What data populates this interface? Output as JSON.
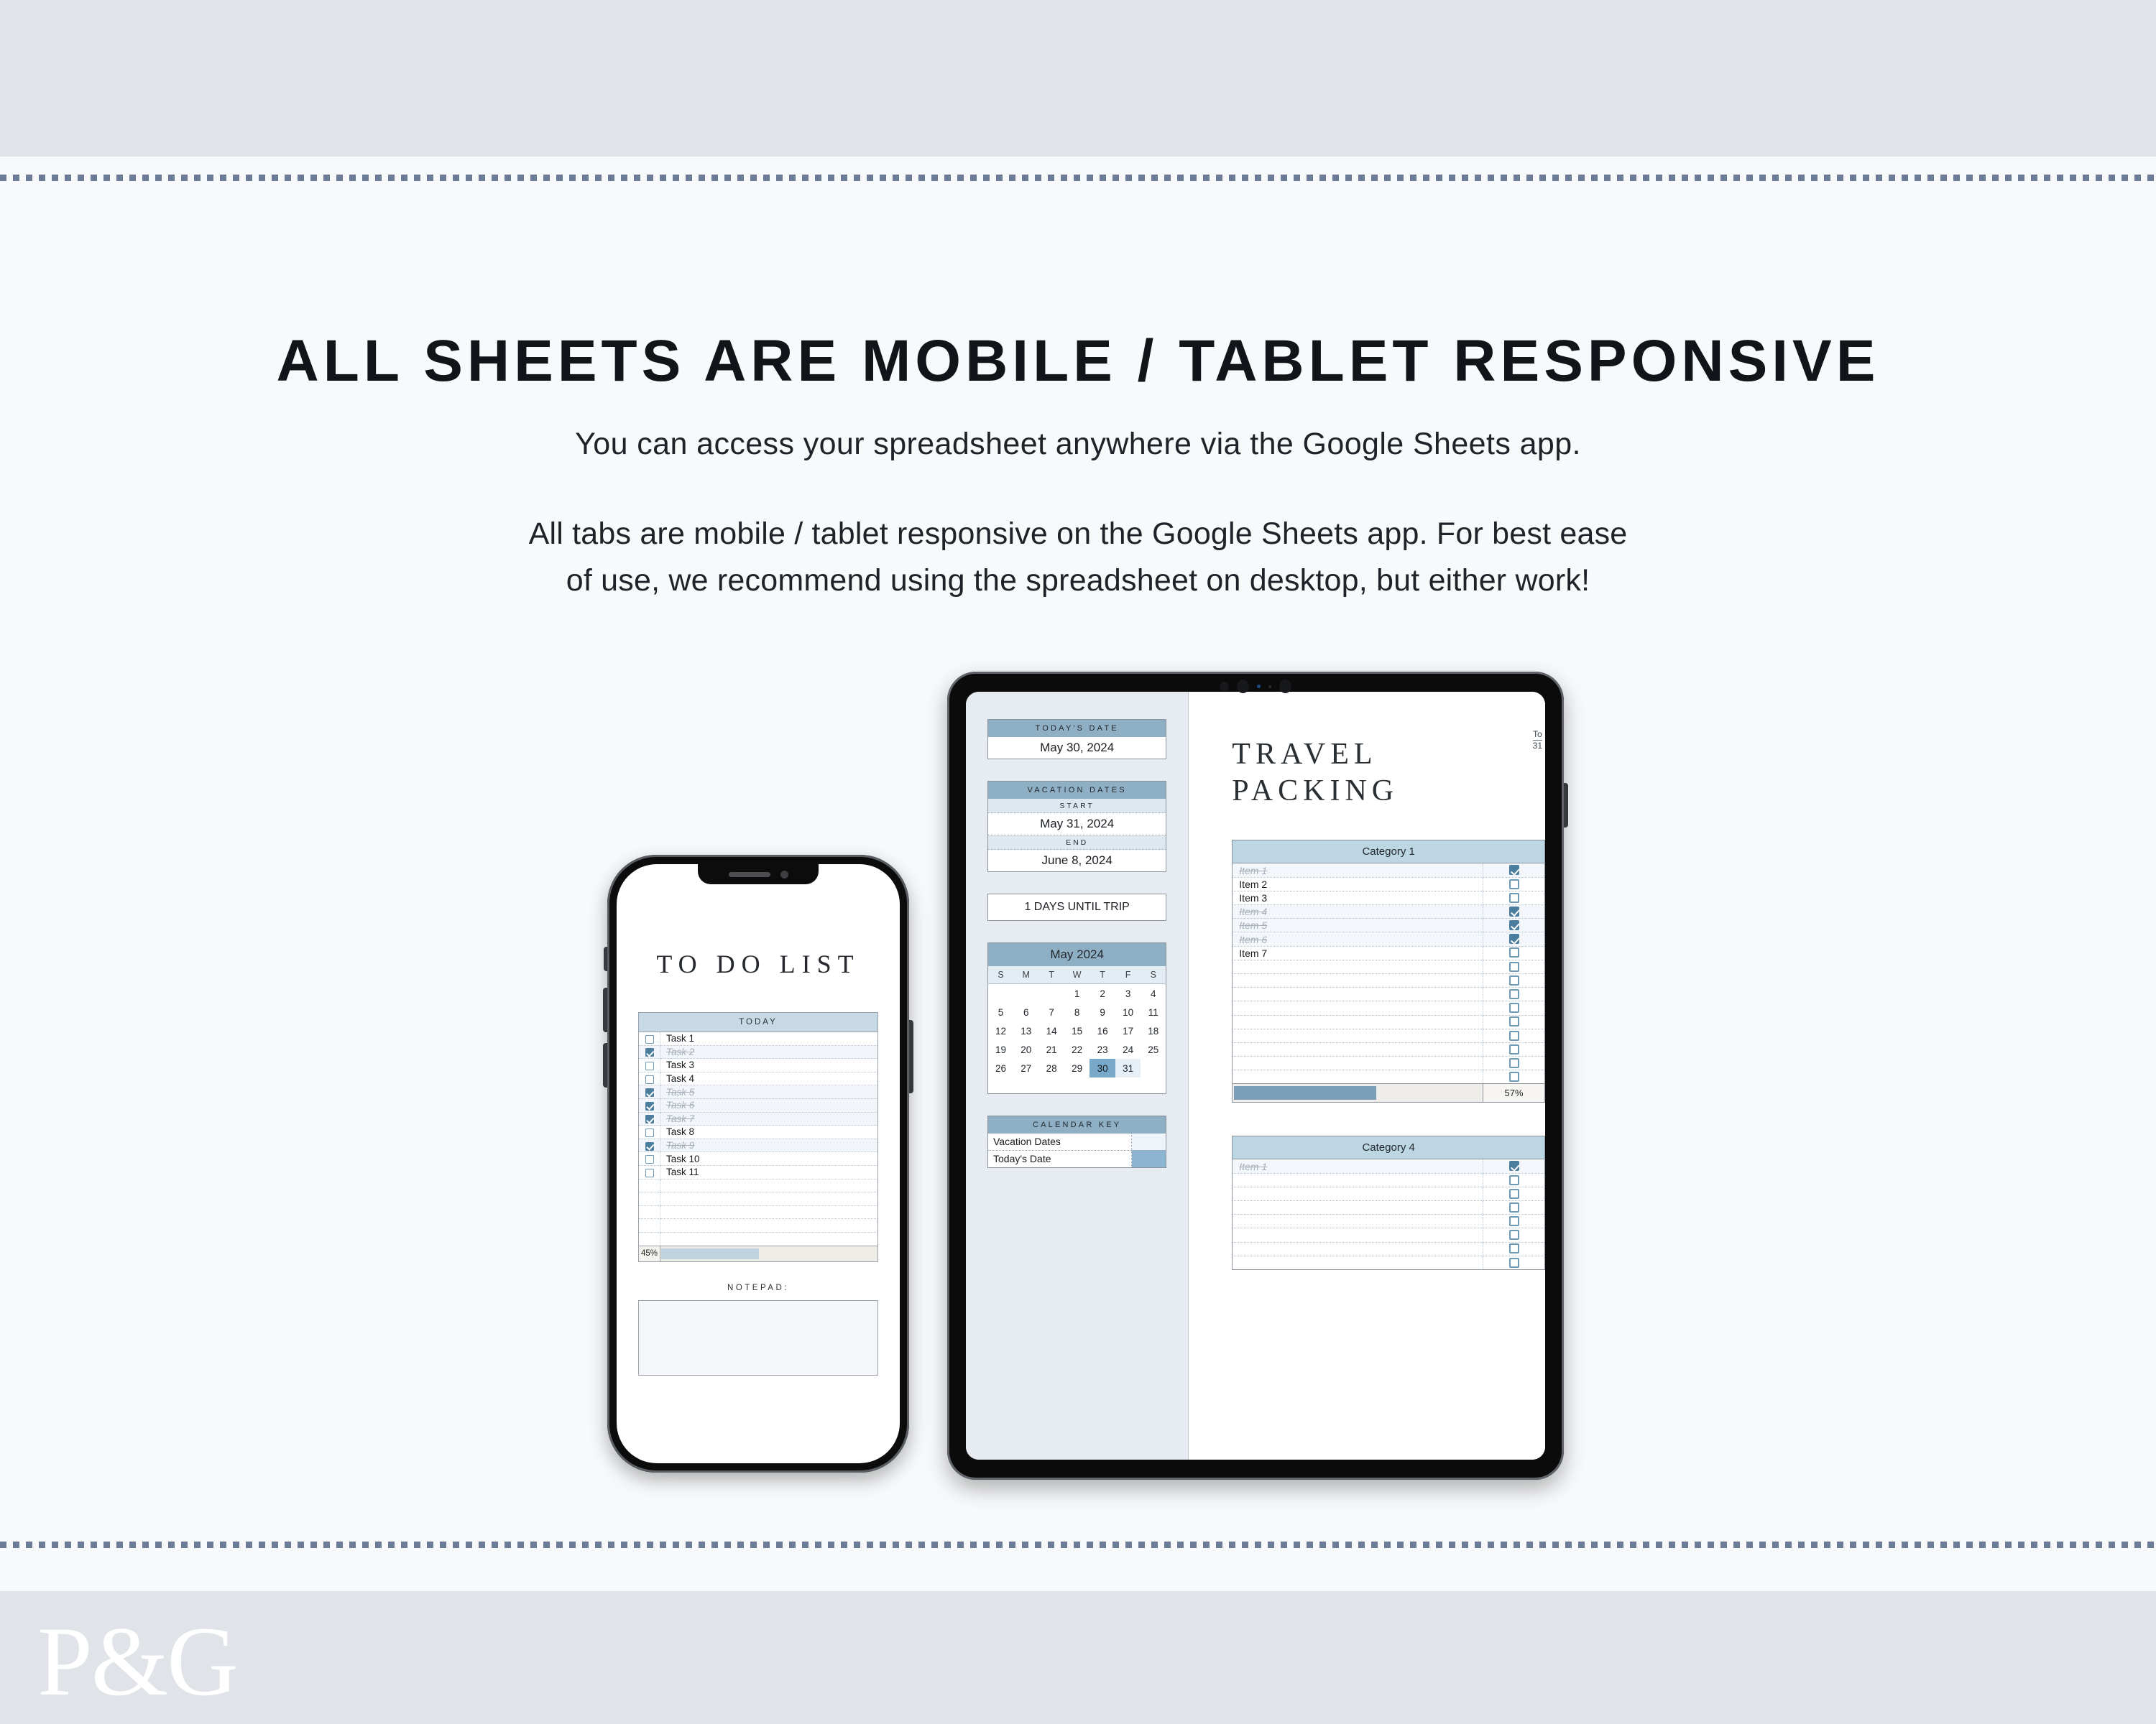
{
  "header": {
    "title": "ALL SHEETS ARE MOBILE / TABLET RESPONSIVE",
    "subtitle": "You can access your spreadsheet anywhere via the Google Sheets app.",
    "body_line1": "All tabs are mobile / tablet responsive on the Google Sheets app. For best ease",
    "body_line2": "of use, we recommend using the spreadsheet on desktop, but either work!"
  },
  "footer": {
    "logo": "P&G"
  },
  "colors": {
    "band": "#e0e3e8",
    "page_bg": "#f7f9fb",
    "dotted_rule": "#6c7c96",
    "accent_header_dark": "#8fafc5",
    "accent_header_light": "#c6d9e5",
    "accent_header_pack": "#bcd6e3",
    "checkbox_checked": "#4b7d9e",
    "checkbox_border": "#6f9ab5",
    "progress_fill_phone": "#c0d3e0",
    "progress_fill_tablet": "#7c9fb8",
    "today_highlight": "#79a9c8",
    "vacation_highlight": "#e7f0f7",
    "tablet_left_panel": "#e6ecf1"
  },
  "phone": {
    "device": "iphone-mockup",
    "screen_title": "TO DO LIST",
    "todo": {
      "header": "TODAY",
      "rows": [
        {
          "label": "Task 1",
          "checked": false
        },
        {
          "label": "Task 2",
          "checked": true
        },
        {
          "label": "Task 3",
          "checked": false
        },
        {
          "label": "Task 4",
          "checked": false
        },
        {
          "label": "Task 5",
          "checked": true
        },
        {
          "label": "Task 6",
          "checked": true
        },
        {
          "label": "Task 7",
          "checked": true
        },
        {
          "label": "Task 8",
          "checked": false
        },
        {
          "label": "Task 9",
          "checked": true
        },
        {
          "label": "Task 10",
          "checked": false
        },
        {
          "label": "Task 11",
          "checked": false
        },
        {
          "label": "",
          "checked": null
        },
        {
          "label": "",
          "checked": null
        },
        {
          "label": "",
          "checked": null
        },
        {
          "label": "",
          "checked": null
        },
        {
          "label": "",
          "checked": null
        }
      ],
      "progress_label": "45%",
      "progress_value": 45
    },
    "notepad_label": "NOTEPAD:",
    "notepad_value": ""
  },
  "tablet": {
    "device": "ipad-mockup",
    "left_panel": {
      "todays_date": {
        "header": "TODAY'S DATE",
        "value": "May 30, 2024"
      },
      "vacation_dates": {
        "header": "VACATION DATES",
        "start_label": "START",
        "start_value": "May 31, 2024",
        "end_label": "END",
        "end_value": "June 8, 2024"
      },
      "countdown": "1 DAYS UNTIL TRIP",
      "calendar": {
        "title": "May 2024",
        "dow": [
          "S",
          "M",
          "T",
          "W",
          "T",
          "F",
          "S"
        ],
        "weeks": [
          [
            "",
            "",
            "",
            "1",
            "2",
            "3",
            "4"
          ],
          [
            "5",
            "6",
            "7",
            "8",
            "9",
            "10",
            "11"
          ],
          [
            "12",
            "13",
            "14",
            "15",
            "16",
            "17",
            "18"
          ],
          [
            "19",
            "20",
            "21",
            "22",
            "23",
            "24",
            "25"
          ],
          [
            "26",
            "27",
            "28",
            "29",
            "30",
            "31",
            ""
          ]
        ],
        "today": "30",
        "vacation": [
          "31"
        ]
      },
      "calendar_key": {
        "header": "CALENDAR KEY",
        "rows": [
          {
            "label": "Vacation Dates",
            "swatch": "vacation"
          },
          {
            "label": "Today's Date",
            "swatch": "today"
          }
        ]
      }
    },
    "right_panel": {
      "title_line1": "TRAVEL",
      "title_line2": "PACKING",
      "edge_snippet_top": "To",
      "edge_snippet_bottom": "31",
      "category1": {
        "header": "Category 1",
        "rows": [
          {
            "label": "Item 1",
            "checked": true
          },
          {
            "label": "Item 2",
            "checked": false
          },
          {
            "label": "Item 3",
            "checked": false
          },
          {
            "label": "Item 4",
            "checked": true
          },
          {
            "label": "Item 5",
            "checked": true
          },
          {
            "label": "Item 6",
            "checked": true
          },
          {
            "label": "Item 7",
            "checked": false
          },
          {
            "label": "",
            "checked": false
          },
          {
            "label": "",
            "checked": false
          },
          {
            "label": "",
            "checked": false
          },
          {
            "label": "",
            "checked": false
          },
          {
            "label": "",
            "checked": false
          },
          {
            "label": "",
            "checked": false
          },
          {
            "label": "",
            "checked": false
          },
          {
            "label": "",
            "checked": false
          },
          {
            "label": "",
            "checked": false
          }
        ],
        "progress_label": "57%",
        "progress_value": 57
      },
      "category4": {
        "header": "Category 4",
        "rows": [
          {
            "label": "Item 1",
            "checked": true
          },
          {
            "label": "",
            "checked": false
          },
          {
            "label": "",
            "checked": false
          },
          {
            "label": "",
            "checked": false
          },
          {
            "label": "",
            "checked": false
          },
          {
            "label": "",
            "checked": false
          },
          {
            "label": "",
            "checked": false
          },
          {
            "label": "",
            "checked": false
          }
        ]
      }
    }
  }
}
